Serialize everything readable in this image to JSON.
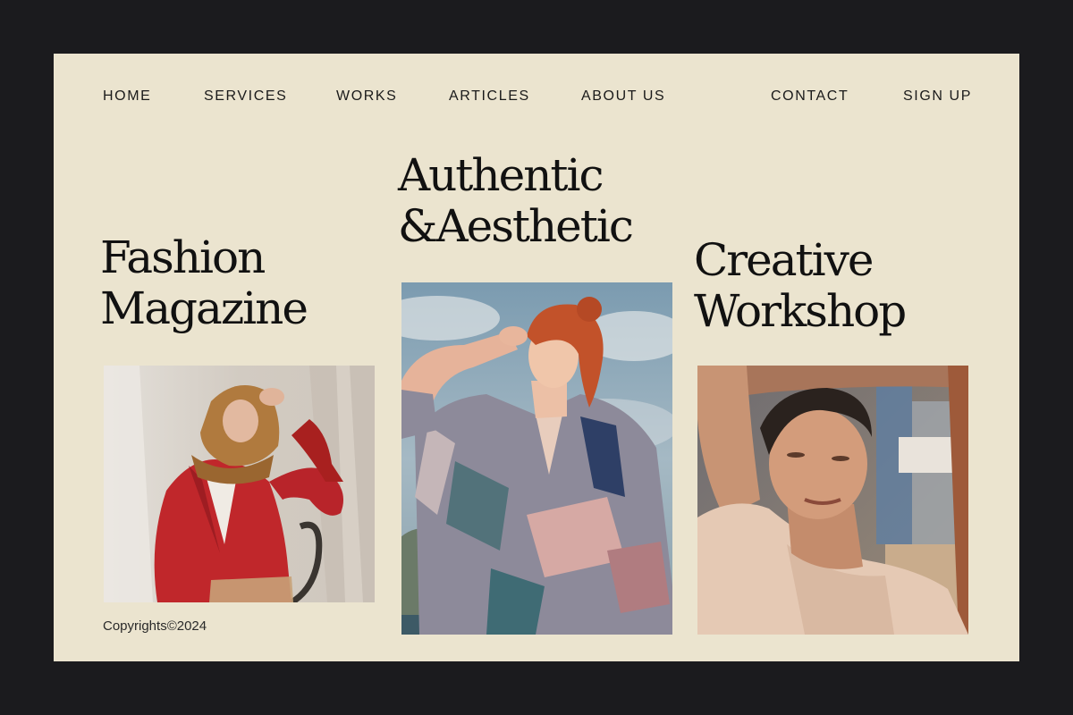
{
  "nav": {
    "home": "HOME",
    "services": "SERVICES",
    "works": "WORKS",
    "articles": "ARTICLES",
    "about": "ABOUT US",
    "contact": "CONTACT",
    "signup": "SIGN UP"
  },
  "headlines": {
    "left": [
      "Fashion",
      "Magazine"
    ],
    "center": [
      "Authentic",
      "&Aesthetic"
    ],
    "right": [
      "Creative",
      "Workshop"
    ]
  },
  "footer": {
    "copyright": "Copyrights©2024"
  },
  "colors": {
    "frame": "#1b1b1e",
    "page_background": "#ebe4cf",
    "text": "#111111"
  }
}
